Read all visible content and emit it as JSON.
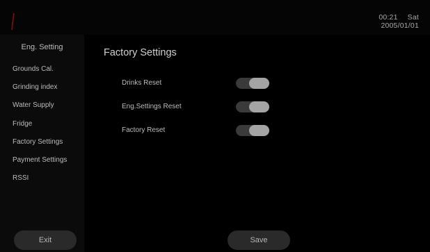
{
  "header": {
    "time": "00:21",
    "weekday": "Sat",
    "date": "2005/01/01",
    "logo_color": "#8a0c0c"
  },
  "sidebar": {
    "title": "Eng. Setting",
    "items": [
      {
        "label": "Grounds Cal."
      },
      {
        "label": "Grinding index"
      },
      {
        "label": "Water Supply"
      },
      {
        "label": "Fridge"
      },
      {
        "label": "Factory Settings"
      },
      {
        "label": "Payment Settings"
      },
      {
        "label": "RSSI"
      }
    ],
    "exit_label": "Exit"
  },
  "main": {
    "title": "Factory Settings",
    "settings": [
      {
        "label": "Drinks Reset",
        "enabled": true
      },
      {
        "label": "Eng.Settings Reset",
        "enabled": true
      },
      {
        "label": "Factory Reset",
        "enabled": true
      }
    ],
    "save_label": "Save"
  }
}
